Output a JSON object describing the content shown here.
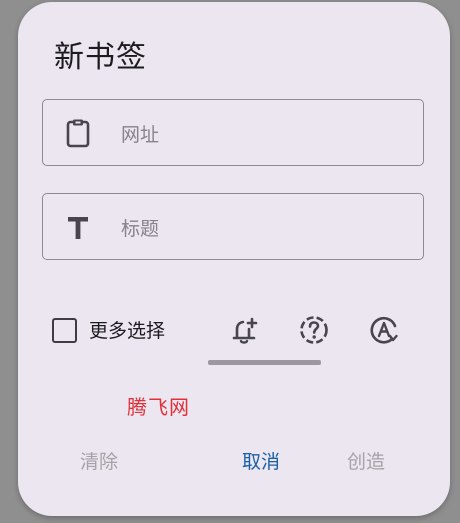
{
  "dialog": {
    "title": "新书签",
    "url_field": {
      "placeholder": "网址",
      "value": "",
      "icon": "clipboard-icon"
    },
    "title_field": {
      "placeholder": "标题",
      "value": "",
      "icon": "text-T-icon"
    },
    "options": {
      "more_options_label": "更多选择",
      "more_options_checked": false,
      "tabs": [
        {
          "icon": "add-alert-bell-icon",
          "selected": true
        },
        {
          "icon": "help-dashed-circle-icon",
          "selected": false
        },
        {
          "icon": "auto-mode-A-icon",
          "selected": false
        }
      ]
    },
    "watermark": "腾飞网",
    "actions": {
      "clear_label": "清除",
      "cancel_label": "取消",
      "create_label": "创造"
    },
    "colors": {
      "background": "#ebe6ef",
      "accent": "#1b5fa8",
      "disabled": "#a5a2a8",
      "watermark": "#e0313a"
    }
  }
}
